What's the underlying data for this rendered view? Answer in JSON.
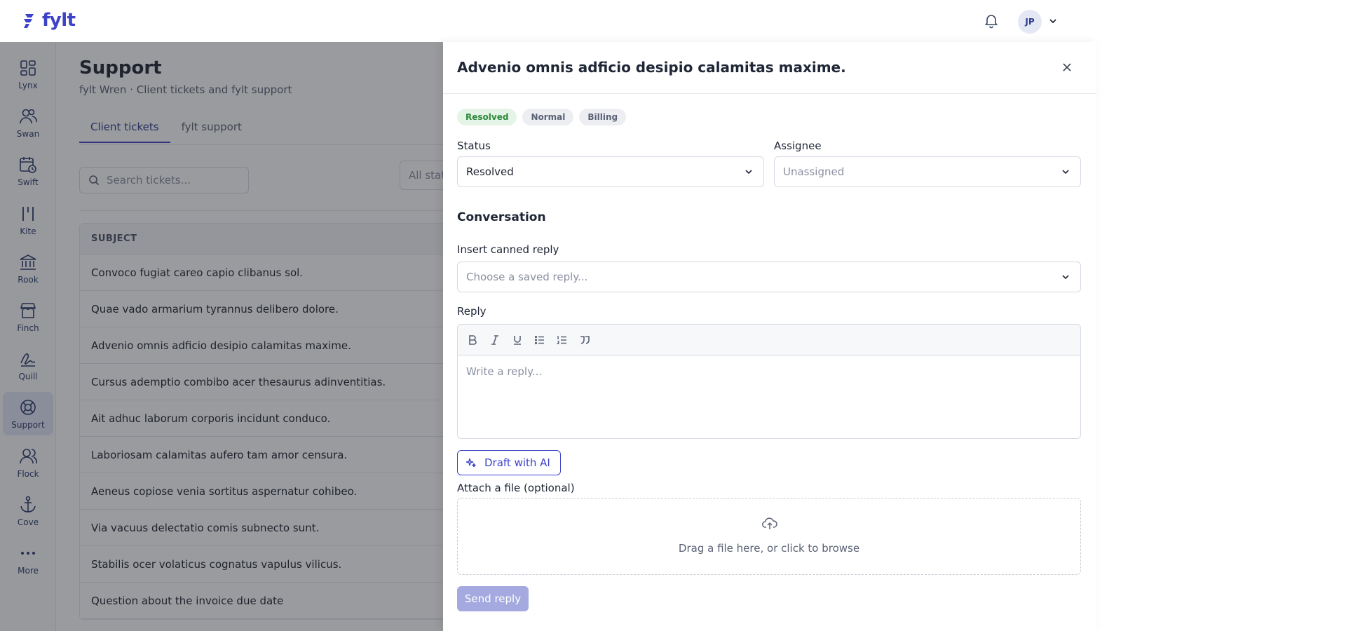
{
  "app": {
    "logo_text": "fylt"
  },
  "header": {
    "avatar_initials": "JP"
  },
  "sidebar": {
    "items": [
      {
        "label": "Lynx",
        "icon": "grid-icon"
      },
      {
        "label": "Swan",
        "icon": "users-icon"
      },
      {
        "label": "Swift",
        "icon": "calendar-clock-icon"
      },
      {
        "label": "Kite",
        "icon": "bars-icon"
      },
      {
        "label": "Rook",
        "icon": "bank-icon"
      },
      {
        "label": "Finch",
        "icon": "store-icon"
      },
      {
        "label": "Quill",
        "icon": "signature-icon"
      },
      {
        "label": "Support",
        "icon": "lifebuoy-icon",
        "active": true
      },
      {
        "label": "Flock",
        "icon": "user-icon"
      },
      {
        "label": "Cove",
        "icon": "anchor-icon"
      },
      {
        "label": "More",
        "icon": "more-icon"
      }
    ]
  },
  "page": {
    "title": "Support",
    "subtitle": "fylt Wren · Client tickets and fylt support",
    "tabs": [
      {
        "label": "Client tickets",
        "active": true
      },
      {
        "label": "fylt support",
        "active": false
      }
    ],
    "search_placeholder": "Search tickets...",
    "status_filter": "All stat",
    "table": {
      "header": "SUBJECT",
      "rows": [
        "Convoco fugiat careo capio clibanus sol.",
        "Quae vado armarium tyrannus delibero dolore.",
        "Advenio omnis adficio desipio calamitas maxime.",
        "Cursus ademptio combibo acer thesaurus adinventitias.",
        "Ait adhuc laborum corporis incidunt conduco.",
        "Laboriosam calamitas aufero tam amor censura.",
        "Aeneus copiose venia sortitus aspernatur cohibeo.",
        "Via vacuus delectatio comis subnecto sunt.",
        "Stabilis ocer volaticus cognatus vapulus vilicus.",
        "Question about the invoice due date"
      ]
    }
  },
  "panel": {
    "title": "Advenio omnis adficio desipio calamitas maxime.",
    "badges": [
      "Resolved",
      "Normal",
      "Billing"
    ],
    "status_label": "Status",
    "status_value": "Resolved",
    "assignee_label": "Assignee",
    "assignee_placeholder": "Unassigned",
    "conversation_title": "Conversation",
    "canned_label": "Insert canned reply",
    "canned_placeholder": "Choose a saved reply...",
    "reply_label": "Reply",
    "reply_placeholder": "Write a reply...",
    "ai_button": "Draft with AI",
    "attach_label": "Attach a file (optional)",
    "dropzone_text": "Drag a file here, or click to browse",
    "send_button": "Send reply"
  },
  "colors": {
    "brand": "#3d43c8",
    "resolved_badge_bg": "#e4f4e6",
    "resolved_badge_text": "#2e8a3a",
    "send_disabled": "#a4aae0"
  }
}
